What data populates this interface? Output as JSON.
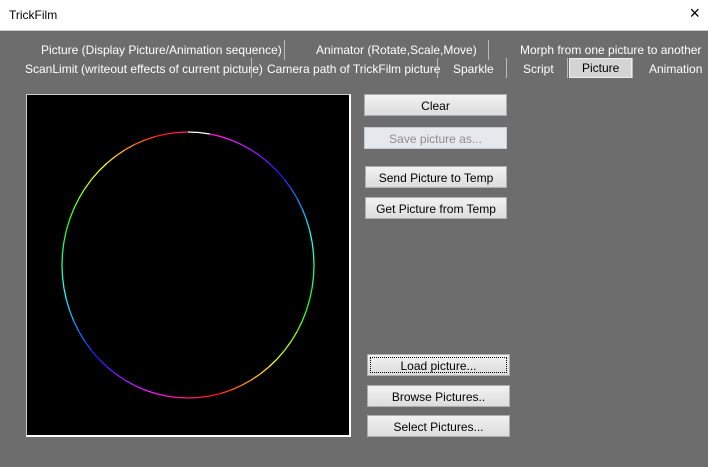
{
  "window": {
    "title": "TrickFilm",
    "close_icon": "×"
  },
  "tabs_row1": [
    "Picture (Display Picture/Animation sequence)",
    "Animator (Rotate,Scale,Move)",
    "Morph from one picture to another"
  ],
  "tabs_row2": [
    "ScanLimit (writeout effects of current picture)",
    "Camera path of TrickFilm picture",
    "Sparkle",
    "Script",
    "Picture",
    "Animation"
  ],
  "active_tab": "Picture",
  "buttons": {
    "clear": "Clear",
    "save": "Save picture as...",
    "send": "Send Picture to Temp",
    "get": "Get Picture from Temp",
    "load": "Load picture...",
    "browse": "Browse Pictures..",
    "select": "Select Pictures..."
  }
}
